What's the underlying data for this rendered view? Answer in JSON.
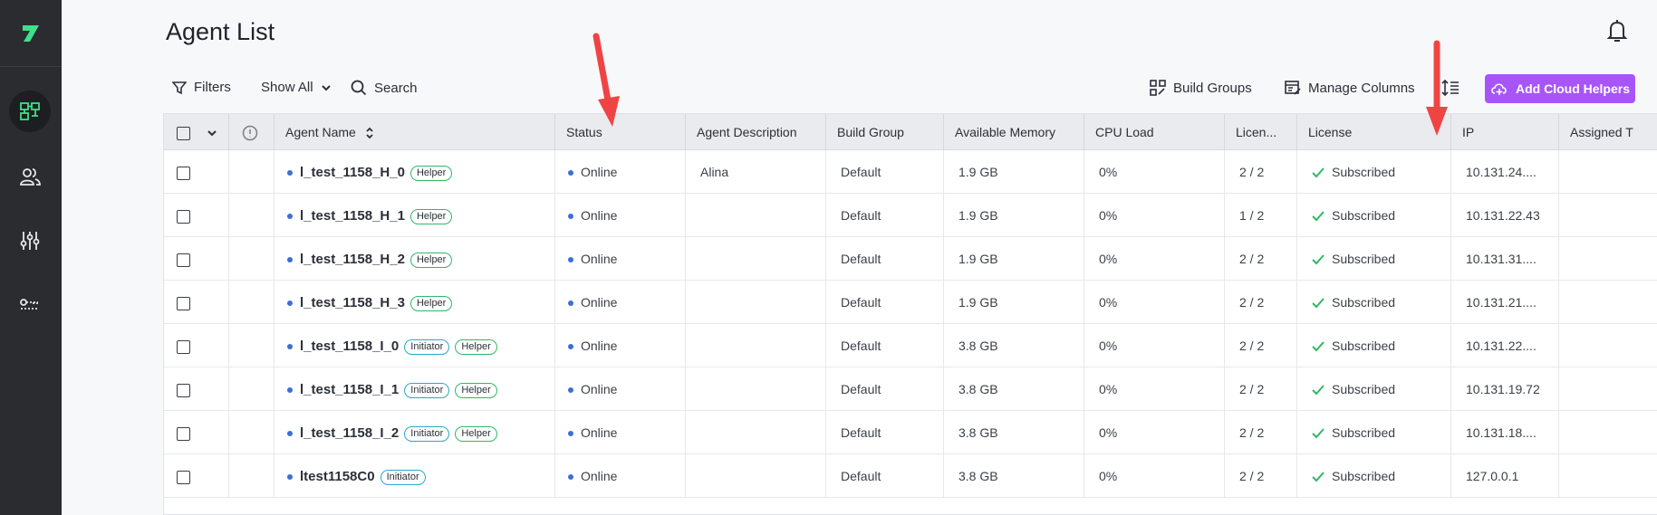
{
  "page": {
    "title": "Agent List"
  },
  "toolbar": {
    "filters_label": "Filters",
    "show_all_label": "Show All",
    "search_label": "Search",
    "build_groups_label": "Build Groups",
    "manage_columns_label": "Manage Columns",
    "add_cloud_helpers_label": "Add Cloud Helpers"
  },
  "colors": {
    "accent": "#a855f7",
    "sidebar": "#2a2c30",
    "online_dot": "#3b6fd6",
    "helper_tag": "#2fb866",
    "initiator_tag": "#2aa7c9",
    "annotation_arrow": "#f04444"
  },
  "icons": [
    "logo-icon",
    "agents-icon",
    "users-icon",
    "settings-sliders-icon",
    "key-icon",
    "bell-icon",
    "filter-icon",
    "chevron-down-icon",
    "search-icon",
    "build-groups-icon",
    "manage-columns-icon",
    "row-height-icon",
    "cloud-plus-icon",
    "info-icon",
    "sort-icon",
    "check-icon"
  ],
  "table": {
    "headers": {
      "agent_name": "Agent Name",
      "status": "Status",
      "agent_description": "Agent Description",
      "build_group": "Build Group",
      "available_memory": "Available Memory",
      "cpu_load": "CPU Load",
      "licenses": "Licen...",
      "license": "License",
      "ip": "IP",
      "assigned": "Assigned T"
    },
    "rows": [
      {
        "name": "l_test_1158_H_0",
        "tags": [
          "Helper"
        ],
        "status": "Online",
        "description": "Alina",
        "build_group": "Default",
        "memory": "1.9 GB",
        "cpu": "0%",
        "licenses": "2 / 2",
        "license": "Subscribed",
        "ip": "10.131.24...."
      },
      {
        "name": "l_test_1158_H_1",
        "tags": [
          "Helper"
        ],
        "status": "Online",
        "description": "",
        "build_group": "Default",
        "memory": "1.9 GB",
        "cpu": "0%",
        "licenses": "1 / 2",
        "license": "Subscribed",
        "ip": "10.131.22.43"
      },
      {
        "name": "l_test_1158_H_2",
        "tags": [
          "Helper"
        ],
        "status": "Online",
        "description": "",
        "build_group": "Default",
        "memory": "1.9 GB",
        "cpu": "0%",
        "licenses": "2 / 2",
        "license": "Subscribed",
        "ip": "10.131.31...."
      },
      {
        "name": "l_test_1158_H_3",
        "tags": [
          "Helper"
        ],
        "status": "Online",
        "description": "",
        "build_group": "Default",
        "memory": "1.9 GB",
        "cpu": "0%",
        "licenses": "2 / 2",
        "license": "Subscribed",
        "ip": "10.131.21...."
      },
      {
        "name": "l_test_1158_I_0",
        "tags": [
          "Initiator",
          "Helper"
        ],
        "status": "Online",
        "description": "",
        "build_group": "Default",
        "memory": "3.8 GB",
        "cpu": "0%",
        "licenses": "2 / 2",
        "license": "Subscribed",
        "ip": "10.131.22...."
      },
      {
        "name": "l_test_1158_I_1",
        "tags": [
          "Initiator",
          "Helper"
        ],
        "status": "Online",
        "description": "",
        "build_group": "Default",
        "memory": "3.8 GB",
        "cpu": "0%",
        "licenses": "2 / 2",
        "license": "Subscribed",
        "ip": "10.131.19.72"
      },
      {
        "name": "l_test_1158_I_2",
        "tags": [
          "Initiator",
          "Helper"
        ],
        "status": "Online",
        "description": "",
        "build_group": "Default",
        "memory": "3.8 GB",
        "cpu": "0%",
        "licenses": "2 / 2",
        "license": "Subscribed",
        "ip": "10.131.18...."
      },
      {
        "name": "ltest1158C0",
        "tags": [
          "Initiator"
        ],
        "status": "Online",
        "description": "",
        "build_group": "Default",
        "memory": "3.8 GB",
        "cpu": "0%",
        "licenses": "2 / 2",
        "license": "Subscribed",
        "ip": "127.0.0.1"
      }
    ]
  }
}
